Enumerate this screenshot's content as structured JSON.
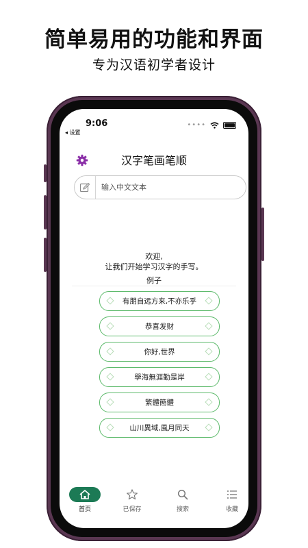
{
  "promo": {
    "headline": "简单易用的功能和界面",
    "subline": "专为汉语初学者设计"
  },
  "status_bar": {
    "time": "9:06",
    "back_label": "◂ 设置"
  },
  "nav": {
    "title": "汉字笔画笔顺",
    "settings_icon": "gear-icon"
  },
  "search": {
    "placeholder": "输入中文文本",
    "value": ""
  },
  "welcome": {
    "line1": "欢迎,",
    "line2": "让我们开始学习汉字的手写。"
  },
  "examples": {
    "label": "例子",
    "items": [
      "有朋自远方来,不亦乐乎",
      "恭喜发财",
      "你好,世界",
      "學海無涯勤是岸",
      "繁體簡體",
      "山川異域,風月同天"
    ]
  },
  "tabs": [
    {
      "label": "首页",
      "icon": "home-icon",
      "active": true
    },
    {
      "label": "已保存",
      "icon": "star-icon",
      "active": false
    },
    {
      "label": "搜索",
      "icon": "search-icon",
      "active": false
    },
    {
      "label": "收藏",
      "icon": "list-icon",
      "active": false
    }
  ],
  "colors": {
    "accent_green": "#1c7a55",
    "example_border": "#5dba6b",
    "gear_purple": "#8b2fa8",
    "phone_frame": "#5a3752"
  }
}
